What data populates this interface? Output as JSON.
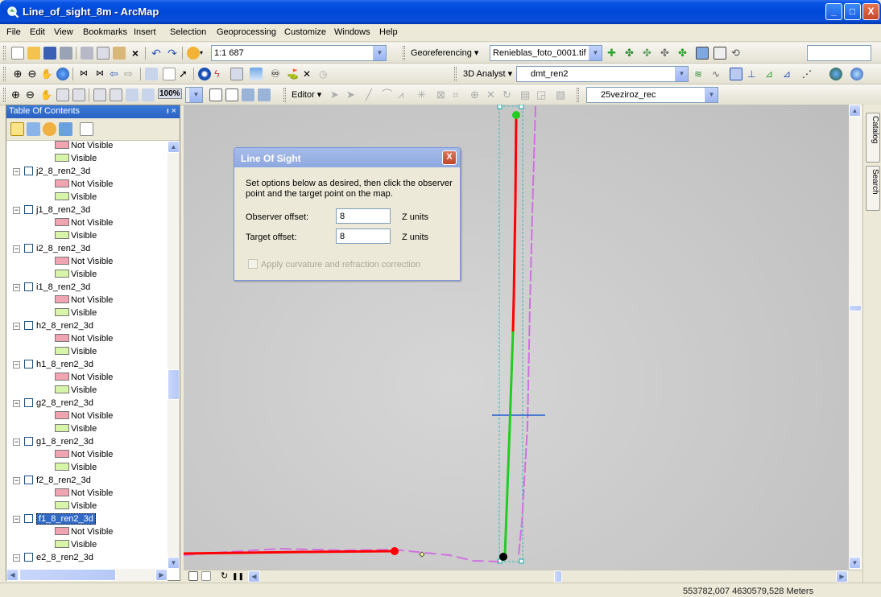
{
  "window": {
    "title": "Line_of_sight_8m - ArcMap",
    "minimize": "_",
    "maximize": "□",
    "close": "X"
  },
  "menu": [
    "File",
    "Edit",
    "View",
    "Bookmarks",
    "Insert",
    "Selection",
    "Geoprocessing",
    "Customize",
    "Windows",
    "Help"
  ],
  "toolbar1": {
    "scale": "1:1 687",
    "georef_label": "Georeferencing ▾",
    "georef_layer": "Renieblas_foto_0001.tif"
  },
  "toolbar2": {
    "analyst_label": "3D Analyst ▾",
    "analyst_layer": "dmt_ren2"
  },
  "toolbar3": {
    "zoom": "100%",
    "editor_label": "Editor ▾",
    "layer_combo": "25veziroz_rec"
  },
  "toc": {
    "title": "Table Of Contents",
    "header_btns": "ᵻ ×",
    "items": [
      {
        "type": "class",
        "label": "Not Visible",
        "swatch": "red"
      },
      {
        "type": "class",
        "label": "Visible",
        "swatch": "green"
      },
      {
        "type": "layer",
        "label": "j2_8_ren2_3d"
      },
      {
        "type": "class",
        "label": "Not Visible",
        "swatch": "red"
      },
      {
        "type": "class",
        "label": "Visible",
        "swatch": "green"
      },
      {
        "type": "layer",
        "label": "j1_8_ren2_3d"
      },
      {
        "type": "class",
        "label": "Not Visible",
        "swatch": "red"
      },
      {
        "type": "class",
        "label": "Visible",
        "swatch": "green"
      },
      {
        "type": "layer",
        "label": "i2_8_ren2_3d"
      },
      {
        "type": "class",
        "label": "Not Visible",
        "swatch": "red"
      },
      {
        "type": "class",
        "label": "Visible",
        "swatch": "green"
      },
      {
        "type": "layer",
        "label": "i1_8_ren2_3d"
      },
      {
        "type": "class",
        "label": "Not Visible",
        "swatch": "red"
      },
      {
        "type": "class",
        "label": "Visible",
        "swatch": "green"
      },
      {
        "type": "layer",
        "label": "h2_8_ren2_3d"
      },
      {
        "type": "class",
        "label": "Not Visible",
        "swatch": "red"
      },
      {
        "type": "class",
        "label": "Visible",
        "swatch": "green"
      },
      {
        "type": "layer",
        "label": "h1_8_ren2_3d"
      },
      {
        "type": "class",
        "label": "Not Visible",
        "swatch": "red"
      },
      {
        "type": "class",
        "label": "Visible",
        "swatch": "green"
      },
      {
        "type": "layer",
        "label": "g2_8_ren2_3d"
      },
      {
        "type": "class",
        "label": "Not Visible",
        "swatch": "red"
      },
      {
        "type": "class",
        "label": "Visible",
        "swatch": "green"
      },
      {
        "type": "layer",
        "label": "g1_8_ren2_3d"
      },
      {
        "type": "class",
        "label": "Not Visible",
        "swatch": "red"
      },
      {
        "type": "class",
        "label": "Visible",
        "swatch": "green"
      },
      {
        "type": "layer",
        "label": "f2_8_ren2_3d"
      },
      {
        "type": "class",
        "label": "Not Visible",
        "swatch": "red"
      },
      {
        "type": "class",
        "label": "Visible",
        "swatch": "green"
      },
      {
        "type": "layer",
        "label": "f1_8_ren2_3d",
        "selected": true
      },
      {
        "type": "class",
        "label": "Not Visible",
        "swatch": "red"
      },
      {
        "type": "class",
        "label": "Visible",
        "swatch": "green"
      },
      {
        "type": "layer",
        "label": "e2_8_ren2_3d"
      }
    ]
  },
  "dialog": {
    "title": "Line Of Sight",
    "close": "X",
    "description": "Set options below as desired, then click the observer point and the target point on the map.",
    "observer_label": "Observer offset:",
    "observer_value": "8",
    "target_label": "Target offset:",
    "target_value": "8",
    "units": "Z units",
    "curvature_label": "Apply curvature and refraction correction"
  },
  "dock": {
    "catalog": "Catalog",
    "search": "Search"
  },
  "status": {
    "coordinates": "553782,007  4630579,528 Meters"
  },
  "colors": {
    "visible": "#22cc22",
    "not_visible": "#ff0000",
    "profile": "#d070e0",
    "crosshair": "#2060d0"
  }
}
